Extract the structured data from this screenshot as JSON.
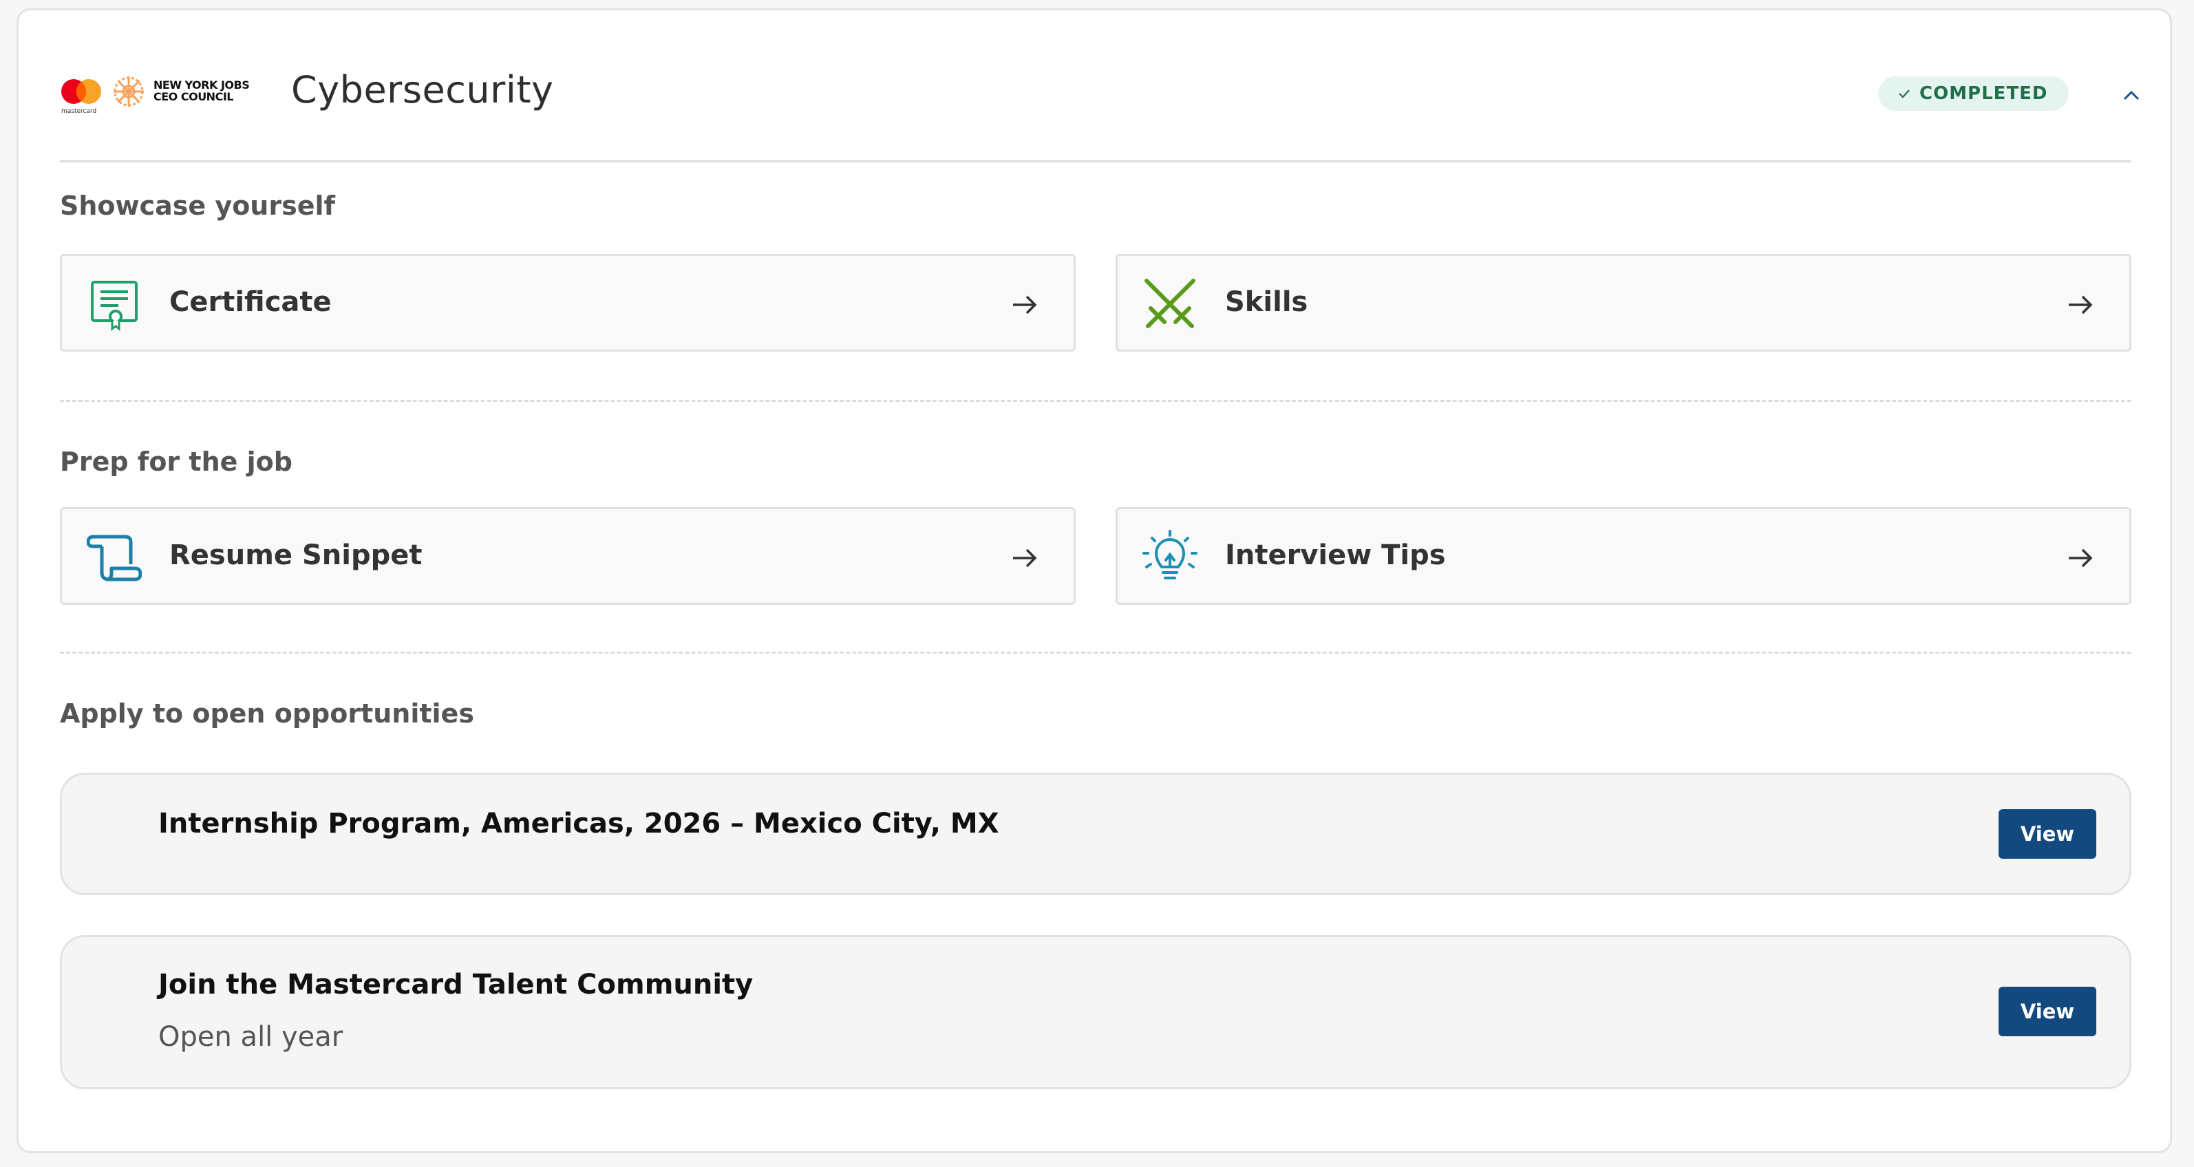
{
  "header": {
    "logo_text_line1": "NEW YORK JOBS",
    "logo_text_line2": "CEO COUNCIL",
    "mastercard_wordmark": "mastercard",
    "title": "Cybersecurity",
    "status_badge": "COMPLETED",
    "status_icon": "check-icon",
    "collapse_icon": "chevron-up-icon"
  },
  "sections": {
    "showcase": {
      "title": "Showcase yourself",
      "items": [
        {
          "label": "Certificate",
          "icon": "certificate-icon"
        },
        {
          "label": "Skills",
          "icon": "crossed-swords-icon"
        }
      ]
    },
    "prep": {
      "title": "Prep for the job",
      "items": [
        {
          "label": "Resume Snippet",
          "icon": "scroll-icon"
        },
        {
          "label": "Interview Tips",
          "icon": "lightbulb-icon"
        }
      ]
    },
    "apply": {
      "title": "Apply to open opportunities",
      "opportunities": [
        {
          "title": "Internship Program, Americas, 2026 – Mexico City, MX",
          "button": "View"
        },
        {
          "title": "Join the Mastercard Talent Community",
          "subtitle": "Open all year",
          "button": "View"
        }
      ]
    }
  },
  "colors": {
    "badge_bg": "#e5f4ee",
    "badge_text": "#1f6f4b",
    "certificate_icon": "#1f9e6a",
    "skills_icon": "#5a9a1a",
    "resume_icon": "#1d7fa6",
    "interview_icon": "#1d8fb5",
    "button_bg": "#12497f"
  }
}
